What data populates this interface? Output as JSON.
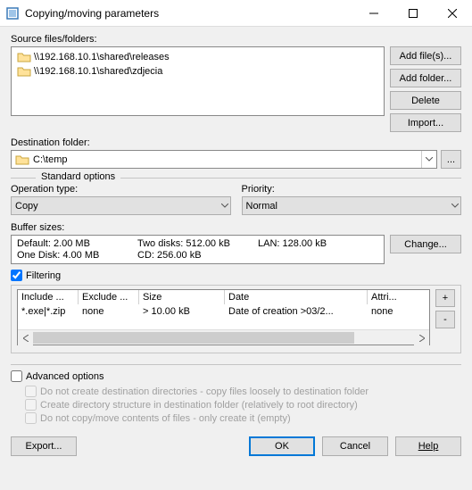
{
  "window": {
    "title": "Copying/moving parameters"
  },
  "source": {
    "label": "Source files/folders:",
    "items": [
      {
        "path": "\\\\192.168.10.1\\shared\\releases"
      },
      {
        "path": "\\\\192.168.10.1\\shared\\zdjecia"
      }
    ]
  },
  "sidebuttons": {
    "add_files": "Add file(s)...",
    "add_folder": "Add folder...",
    "delete": "Delete",
    "import": "Import..."
  },
  "destination": {
    "label": "Destination folder:",
    "value": "C:\\temp",
    "browse": "..."
  },
  "standard_options": {
    "legend": "Standard options",
    "operation_label": "Operation type:",
    "operation_value": "Copy",
    "priority_label": "Priority:",
    "priority_value": "Normal"
  },
  "buffer": {
    "label": "Buffer sizes:",
    "default": "Default: 2.00 MB",
    "two_disks": "Two disks: 512.00 kB",
    "lan": "LAN: 128.00 kB",
    "one_disk": "One Disk: 4.00 MB",
    "cd": "CD: 256.00 kB",
    "change": "Change..."
  },
  "filtering": {
    "checkbox_label": "Filtering",
    "checked": true,
    "headers": {
      "include": "Include ...",
      "exclude": "Exclude ...",
      "size": "Size",
      "date": "Date",
      "attr": "Attri..."
    },
    "row": {
      "include": "*.exe|*.zip",
      "exclude": "none",
      "size": "> 10.00 kB",
      "date": "Date of creation >03/2...",
      "attr": "none"
    },
    "add": "+",
    "remove": "-"
  },
  "advanced": {
    "checkbox_label": "Advanced options",
    "checked": false,
    "opt1": "Do not create destination directories - copy files loosely to destination folder",
    "opt2": "Create directory structure in destination folder (relatively to root directory)",
    "opt3": "Do not copy/move contents of files - only create it (empty)"
  },
  "footer": {
    "export": "Export...",
    "ok": "OK",
    "cancel": "Cancel",
    "help": "Help"
  }
}
